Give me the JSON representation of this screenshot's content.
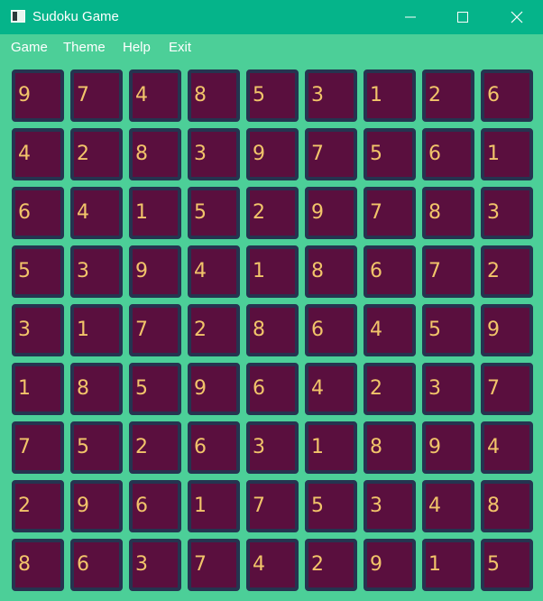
{
  "window": {
    "title": "Sudoku Game",
    "icon": "app-window-icon"
  },
  "colors": {
    "titlebar": "#05b48a",
    "background": "#4ccf98",
    "cell_fill": "#5a0f3e",
    "cell_border": "#253450",
    "digit": "#f2c46a"
  },
  "menu": {
    "items": [
      "Game",
      "Theme",
      "Help",
      "Exit"
    ]
  },
  "board": {
    "rows": [
      [
        "9",
        "7",
        "4",
        "8",
        "5",
        "3",
        "1",
        "2",
        "6"
      ],
      [
        "4",
        "2",
        "8",
        "3",
        "9",
        "7",
        "5",
        "6",
        "1"
      ],
      [
        "6",
        "4",
        "1",
        "5",
        "2",
        "9",
        "7",
        "8",
        "3"
      ],
      [
        "5",
        "3",
        "9",
        "4",
        "1",
        "8",
        "6",
        "7",
        "2"
      ],
      [
        "3",
        "1",
        "7",
        "2",
        "8",
        "6",
        "4",
        "5",
        "9"
      ],
      [
        "1",
        "8",
        "5",
        "9",
        "6",
        "4",
        "2",
        "3",
        "7"
      ],
      [
        "7",
        "5",
        "2",
        "6",
        "3",
        "1",
        "8",
        "9",
        "4"
      ],
      [
        "2",
        "9",
        "6",
        "1",
        "7",
        "5",
        "3",
        "4",
        "8"
      ],
      [
        "8",
        "6",
        "3",
        "7",
        "4",
        "2",
        "9",
        "1",
        "5"
      ]
    ]
  }
}
